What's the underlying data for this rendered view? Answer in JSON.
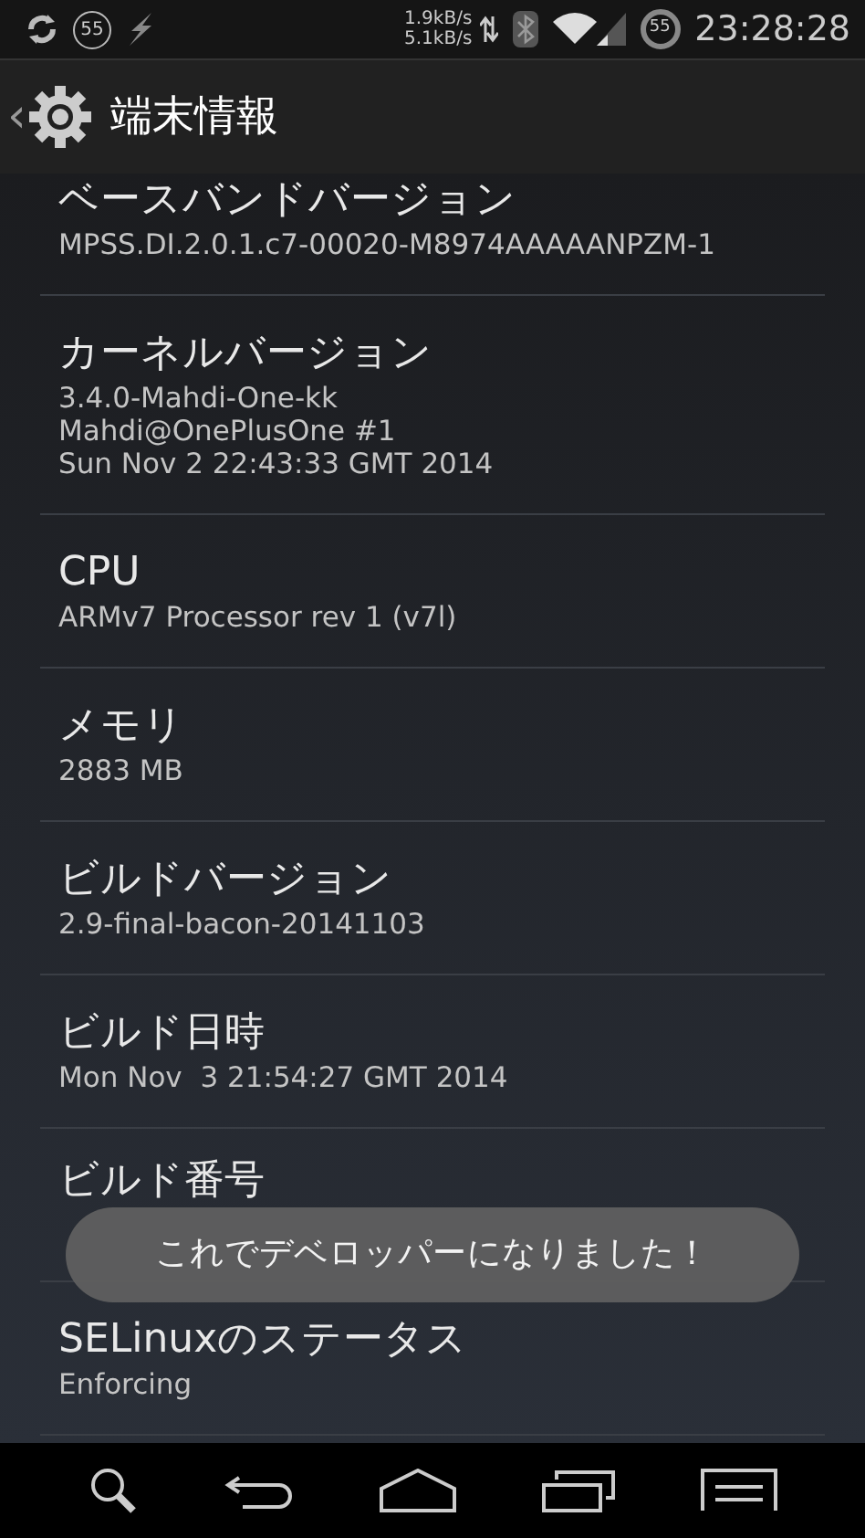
{
  "status_bar": {
    "speed_up": "1.9kB/s",
    "speed_down": "5.1kB/s",
    "notification_badge": "55",
    "battery": "55",
    "time": "23:28:28"
  },
  "header": {
    "back": "‹",
    "title": "端末情報"
  },
  "items": [
    {
      "title": "ベースバンドバージョン",
      "lines": [
        "MPSS.DI.2.0.1.c7-00020-M8974AAAAANPZM-1"
      ]
    },
    {
      "title": "カーネルバージョン",
      "lines": [
        "3.4.0-Mahdi-One-kk",
        "Mahdi@OnePlusOne #1",
        "Sun Nov 2 22:43:33 GMT 2014"
      ]
    },
    {
      "title": "CPU",
      "lines": [
        "ARMv7 Processor rev 1 (v7l)"
      ]
    },
    {
      "title": "メモリ",
      "lines": [
        "2883 MB"
      ]
    },
    {
      "title": "ビルドバージョン",
      "lines": [
        "2.9-final-bacon-20141103"
      ]
    },
    {
      "title": "ビルド日時",
      "lines": [
        "Mon Nov  3 21:54:27 GMT 2014"
      ]
    },
    {
      "title": "ビルド番号"
    },
    {
      "title": "SELinuxのステータス",
      "lines": [
        "Enforcing"
      ]
    }
  ],
  "toast": "これでデベロッパーになりました！"
}
